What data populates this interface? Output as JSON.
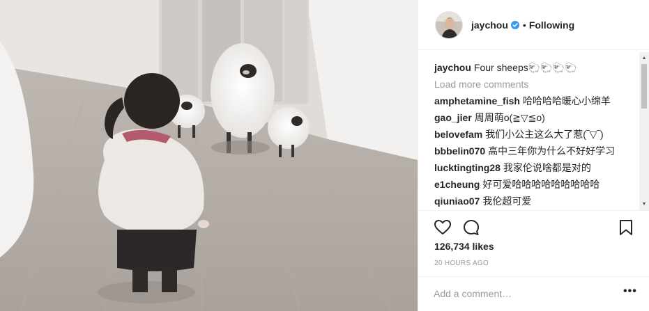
{
  "post": {
    "photo_alt": "Photo",
    "author": {
      "username": "jaychou",
      "verified_icon": "verified-badge-icon",
      "separator": "•",
      "follow_status": "Following"
    },
    "caption": {
      "username": "jaychou",
      "text": "Four sheeps🐑🐑🐑🐑"
    },
    "load_more_label": "Load more comments",
    "comments": [
      {
        "username": "amphetamine_fish",
        "text": "哈哈哈哈暖心小绵羊"
      },
      {
        "username": "gao_jier",
        "text": "周周萌o(≧▽≦o)"
      },
      {
        "username": "belovefam",
        "text": "我们小公主这么大了惹(‾▽‾)"
      },
      {
        "username": "bbbelin070",
        "text": "高中三年你为什么不好好学习"
      },
      {
        "username": "lucktingting28",
        "text": "我家伦说啥都是对的"
      },
      {
        "username": "e1cheung",
        "text": "好可爱哈哈哈哈哈哈哈哈哈"
      },
      {
        "username": "qiuniao07",
        "text": "我伦超可爱"
      }
    ],
    "likes": "126,734 likes",
    "timestamp": "20 HOURS AGO",
    "add_comment_placeholder": "Add a comment…",
    "more_options": "•••",
    "colors": {
      "text": "#262626",
      "muted": "#999999",
      "verified": "#3897f0",
      "border": "#efefef"
    }
  }
}
